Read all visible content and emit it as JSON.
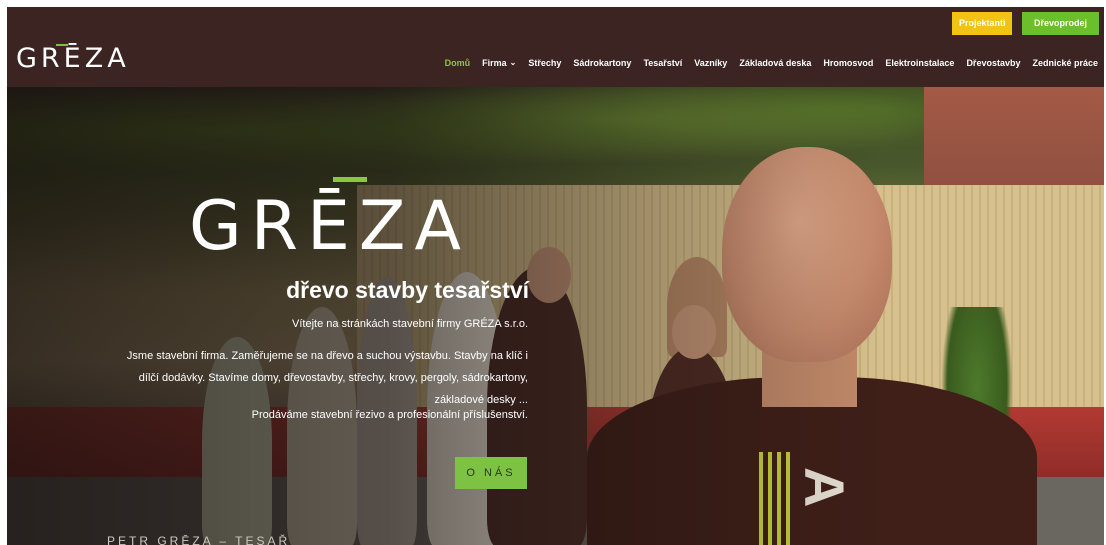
{
  "header": {
    "logo": "GRĒZA",
    "top_buttons": {
      "projektanti": "Projektanti",
      "drevoprodej": "Dřevoprodej"
    },
    "nav": [
      "Domů",
      "Firma",
      "Střechy",
      "Sádrokartony",
      "Tesařství",
      "Vazníky",
      "Základová deska",
      "Hromosvod",
      "Elektroinstalace",
      "Dřevostavby",
      "Zednické práce"
    ],
    "active_nav": "Domů"
  },
  "hero": {
    "logo": "GRĒZA",
    "tagline": "dřevo stavby tesařství",
    "welcome": "Vítejte na stránkách stavební firmy GRÉZA s.r.o.",
    "description_line1": "Jsme stavební firma. Zaměřujeme se na dřevo a suchou výstavbu. Stavby na klíč i",
    "description_line2": "dílčí dodávky. Stavíme domy, dřevostavby, střechy, krovy, pergoly, sádrokartony,",
    "description_line3": "základové desky ...",
    "sell_text": "Prodáváme stavební řezivo a profesionální příslušenství.",
    "button": "O NÁS",
    "caption": "PETR GRĒZA – TESAŘ",
    "shirt_letter": "A"
  },
  "colors": {
    "brand_green": "#7dc242",
    "header_bg": "#3b2421",
    "button_yellow": "#f3c313"
  }
}
